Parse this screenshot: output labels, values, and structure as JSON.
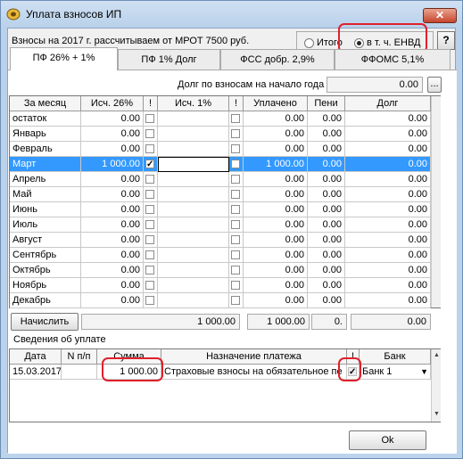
{
  "window": {
    "title": "Уплата взносов ИП",
    "close_label": "✕"
  },
  "header": {
    "note": "Взносы на 2017 г. рассчитываем от МРОТ 7500 руб.",
    "radio_total": "Итого",
    "radio_envd": "в т. ч. ЕНВД",
    "help_label": "?"
  },
  "tabs": [
    "ПФ 26% + 1%",
    "ПФ 1% Долг",
    "ФСС добр. 2,9%",
    "ФФОМС 5,1%"
  ],
  "debt_label": "Долг по взносам на начало года",
  "debt_value": "0.00",
  "debt_button": "...",
  "table": {
    "headers": [
      "За месяц",
      "Исч. 26%",
      "!",
      "Исч. 1%",
      "!",
      "Уплачено",
      "Пени",
      "Долг"
    ],
    "rows": [
      {
        "month": "остаток",
        "calc26": "0.00",
        "paid": "0.00",
        "peni": "0.00",
        "debt": "0.00"
      },
      {
        "month": "Январь",
        "calc26": "0.00",
        "paid": "0.00",
        "peni": "0.00",
        "debt": "0.00"
      },
      {
        "month": "Февраль",
        "calc26": "0.00",
        "paid": "0.00",
        "peni": "0.00",
        "debt": "0.00"
      },
      {
        "month": "Март",
        "calc26": "1 000.00",
        "paid": "1 000.00",
        "peni": "0.00",
        "debt": "0.00"
      },
      {
        "month": "Апрель",
        "calc26": "0.00",
        "paid": "0.00",
        "peni": "0.00",
        "debt": "0.00"
      },
      {
        "month": "Май",
        "calc26": "0.00",
        "paid": "0.00",
        "peni": "0.00",
        "debt": "0.00"
      },
      {
        "month": "Июнь",
        "calc26": "0.00",
        "paid": "0.00",
        "peni": "0.00",
        "debt": "0.00"
      },
      {
        "month": "Июль",
        "calc26": "0.00",
        "paid": "0.00",
        "peni": "0.00",
        "debt": "0.00"
      },
      {
        "month": "Август",
        "calc26": "0.00",
        "paid": "0.00",
        "peni": "0.00",
        "debt": "0.00"
      },
      {
        "month": "Сентябрь",
        "calc26": "0.00",
        "paid": "0.00",
        "peni": "0.00",
        "debt": "0.00"
      },
      {
        "month": "Октябрь",
        "calc26": "0.00",
        "paid": "0.00",
        "peni": "0.00",
        "debt": "0.00"
      },
      {
        "month": "Ноябрь",
        "calc26": "0.00",
        "paid": "0.00",
        "peni": "0.00",
        "debt": "0.00"
      },
      {
        "month": "Декабрь",
        "calc26": "0.00",
        "paid": "0.00",
        "peni": "0.00",
        "debt": "0.00"
      }
    ],
    "selected_row": 3
  },
  "totals": {
    "button": "Начислить",
    "calc26": "1 000.00",
    "paid": "1 000.00",
    "peni": "0.",
    "debt": "0.00"
  },
  "payments": {
    "section_title": "Сведения об уплате",
    "headers": [
      "Дата",
      "N п/п",
      "Сумма",
      "Назначение платежа",
      "!",
      "Банк"
    ],
    "rows": [
      {
        "date": "15.03.2017",
        "num": "",
        "sum": "1 000.00",
        "purpose": "Страховые взносы на обязательное пе",
        "bank": "Банк 1"
      }
    ]
  },
  "ok_label": "Ok",
  "colors": {
    "selection": "#3399ff",
    "highlight": "#e0202a"
  }
}
